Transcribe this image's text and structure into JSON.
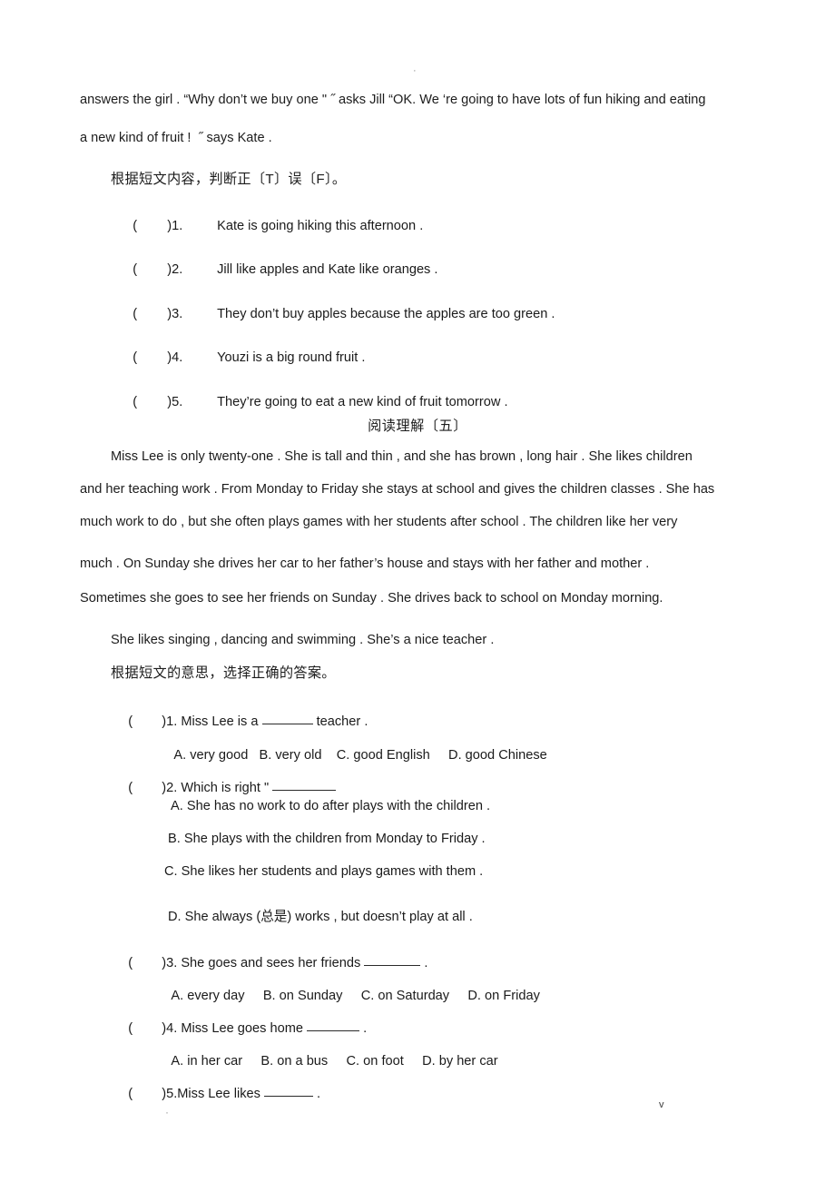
{
  "page": {
    "header_mark": "·",
    "footer_mark_left": "·",
    "footer_mark_right": "v"
  },
  "passage_four": {
    "continuation_line_1": "answers the girl . “Why don’t we buy one \" ˝ asks Jill “OK. We ‘re going to have lots of fun hiking and eating",
    "continuation_line_2": "a new kind of fruit !  ˝ says Kate .",
    "instruction": "根据短文内容，判断正〔T〕误〔F〕。",
    "items": [
      {
        "paren": "(",
        "close": ")",
        "number": "1.",
        "text": "Kate is going hiking this afternoon ."
      },
      {
        "paren": "(",
        "close": ")",
        "number": "2.",
        "text": "Jill like apples and Kate like oranges ."
      },
      {
        "paren": "(",
        "close": ")",
        "number": "3.",
        "text": "They don’t buy apples because the apples are too green ."
      },
      {
        "paren": "(",
        "close": ")",
        "number": "4.",
        "text": "Youzi is a big round fruit ."
      },
      {
        "paren": "(",
        "close": ")",
        "number": "5.",
        "text": "They’re going to eat a new kind of fruit tomorrow ."
      }
    ]
  },
  "passage_five": {
    "heading": "阅读理解〔五〕",
    "paragraph_1_lines": [
      "Miss Lee is only twenty-one . She is tall and thin , and she has brown , long hair . She likes children",
      "and her teaching work . From Monday to Friday she stays at school and gives the children classes . She has",
      "much work to do , but she often plays games with her students after school . The children like her very",
      "much . On Sunday she drives her car to her father’s house and stays with her father and mother .",
      "Sometimes she goes to see her friends on Sunday . She drives back to school on Monday morning."
    ],
    "paragraph_2": "She likes singing , dancing and swimming . She’s a nice teacher .",
    "instruction": "根据短文的意思，选择正确的答案。",
    "questions": [
      {
        "paren": "(",
        "close": ")",
        "stem_before": "1. Miss Lee is a ",
        "stem_after": " teacher .",
        "options_inline": [
          {
            "label": "A. very good"
          },
          {
            "label": "B. very old"
          },
          {
            "label": "C. good English"
          },
          {
            "label": "D. good Chinese"
          }
        ]
      },
      {
        "paren": "(",
        "close": ")",
        "stem_before": "2. Which is right \" ",
        "stem_after": "",
        "options_block": [
          "A. She has no work to do after plays with the children .",
          "B. She plays with the children from Monday to Friday .",
          "C. She likes her students and plays games with them .",
          "D. She always (总是) works , but doesn’t play at all ."
        ]
      },
      {
        "paren": "(",
        "close": ")",
        "stem_before": "3. She goes and sees her friends ",
        "stem_after": " .",
        "options_inline": [
          {
            "label": "A. every day"
          },
          {
            "label": "B. on Sunday"
          },
          {
            "label": "C. on Saturday"
          },
          {
            "label": "D. on Friday"
          }
        ]
      },
      {
        "paren": "(",
        "close": ")",
        "stem_before": "4. Miss Lee goes home ",
        "stem_after": " .",
        "options_inline": [
          {
            "label": "A. in her car"
          },
          {
            "label": "B. on a bus"
          },
          {
            "label": "C. on foot"
          },
          {
            "label": "D. by her car"
          }
        ]
      },
      {
        "paren": "(",
        "close": ")",
        "stem_before": "5.Miss Lee likes ",
        "stem_after": " .",
        "options_inline": []
      }
    ]
  }
}
